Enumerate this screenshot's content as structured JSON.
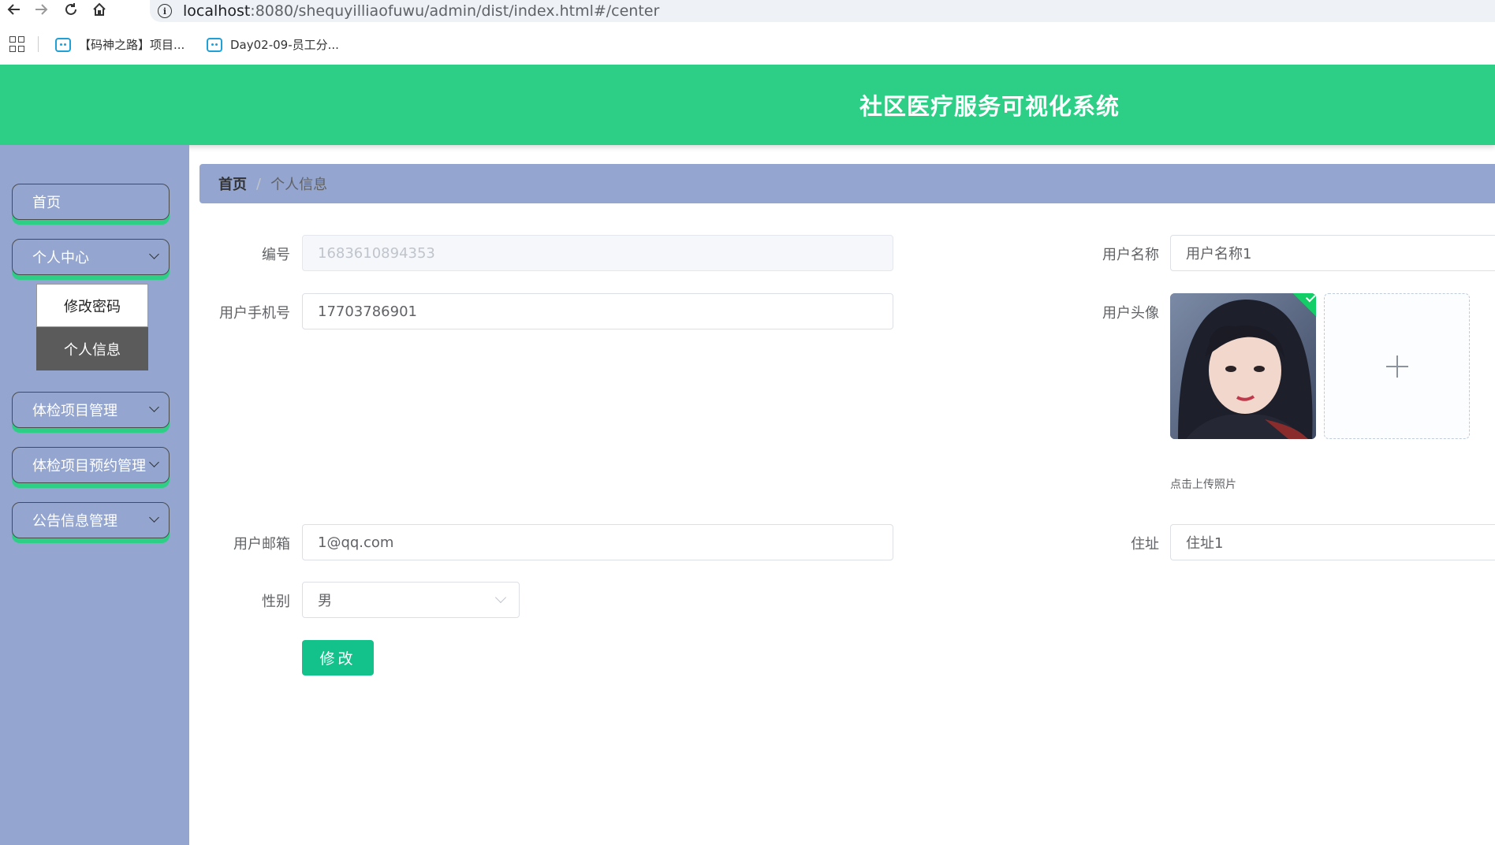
{
  "browser": {
    "url_host": "localhost",
    "url_path": ":8080/shequyilliaofuwu/admin/dist/index.html#/center",
    "bookmarks": [
      {
        "label": "【码神之路】项目..."
      },
      {
        "label": "Day02-09-员工分..."
      }
    ]
  },
  "header": {
    "title": "社区医疗服务可视化系统"
  },
  "sidebar": {
    "items": [
      {
        "label": "首页"
      },
      {
        "label": "个人中心"
      },
      {
        "label": "体检项目管理"
      },
      {
        "label": "体检项目预约管理"
      },
      {
        "label": "公告信息管理"
      }
    ],
    "submenu": [
      {
        "label": "修改密码"
      },
      {
        "label": "个人信息"
      }
    ]
  },
  "breadcrumb": {
    "home": "首页",
    "separator": "/",
    "current": "个人信息"
  },
  "form": {
    "id_label": "编号",
    "id_value": "1683610894353",
    "username_label": "用户名称",
    "username_value": "用户名称1",
    "phone_label": "用户手机号",
    "phone_value": "17703786901",
    "avatar_label": "用户头像",
    "upload_hint": "点击上传照片",
    "email_label": "用户邮箱",
    "email_value": "1@qq.com",
    "address_label": "住址",
    "address_value": "住址1",
    "gender_label": "性别",
    "gender_value": "男",
    "submit_label": "修改"
  },
  "colors": {
    "header": "#2dcf86",
    "sidebar": "#94a6d0",
    "button": "#13c28a"
  }
}
